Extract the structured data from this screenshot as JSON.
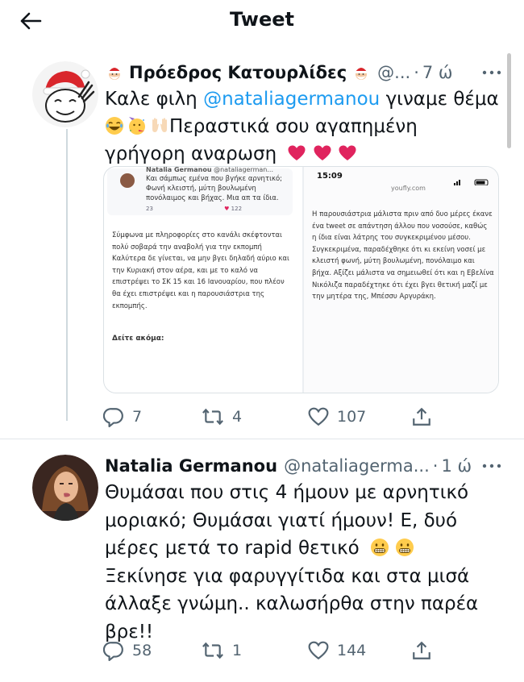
{
  "header": {
    "title": "Tweet"
  },
  "tweet1": {
    "display_name": "Πρόεδρος Κατουρλίδες",
    "handle": "@...",
    "dot": "·",
    "time": "7 ώ",
    "text_prefix": "Καλε φιλη",
    "mention": "@nataliagermanou",
    "text_mid": "γιναμε θέμα",
    "text_line2": "Περαστικά σου αγαπημένη",
    "text_line3": "γρήγορη αναρωση",
    "replies": "7",
    "retweets": "4",
    "likes": "107"
  },
  "media": {
    "embed_name": "Natalia Germanou",
    "embed_handle": "@nataliagerman...",
    "embed_text": [
      "Και σάμπως εμένα που βγήκε αρνητικό;",
      "Φωνή κλειστή, μύτη βουλωμένη",
      "πονόλαιμος και βήχας. Μια απ τα ίδια."
    ],
    "embed_replies": "23",
    "embed_likes": "122",
    "left_paragraph": [
      "Σύμφωνα με πληροφορίες στο κανάλι σκέφτονται",
      "πολύ σοβαρά την αναβολή για την εκπομπή",
      "Καλύτερα δε γίνεται, να μην βγει δηλαδή αύριο και",
      "την Κυριακή στον αέρα, και με το καλό να",
      "επιστρέψει το ΣΚ 15 και 16 Ιανουαρίου, που πλέον",
      "θα έχει επιστρέψει και η παρουσιάστρια της",
      "εκπομπής."
    ],
    "read_more": "Δείτε ακόμα:",
    "phone_time": "15:09",
    "site": "youfly.com",
    "right_paragraph": [
      "Η παρουσιάστρια μάλιστα πριν από δυο μέρες έκανε",
      "ένα tweet σε απάντηση άλλου που νοσούσε, καθώς",
      "η ίδια είναι λάτρης του συγκεκριμένου μέσου.",
      "Συγκεκριμένα, παραδέχθηκε ότι κι εκείνη νοσεί με",
      "κλειστή φωνή, μύτη βουλωμένη, πονόλαιμο και",
      "βήχα. Αξίζει μάλιστα να σημειωθεί ότι και η Εβελίνα",
      "Νικόλιζα παραδέχτηκε ότι έχει βγει θετική μαζί με",
      "την μητέρα της, Μπέσσυ Αργυράκη."
    ]
  },
  "tweet2": {
    "display_name": "Natalia Germanou",
    "handle": "@nataliagerma...",
    "dot": "·",
    "time": "1 ώ",
    "lines": [
      "Θυμάσαι που στις 4 ήμουν με αρνητικό",
      "μοριακό; Θυμάσαι γιατί ήμουν! Ε, δυό",
      "μέρες μετά το rapid θετικό",
      "Ξεκίνησε για φαρυγγίτιδα και στα μισά",
      "άλλαξε γνώμη.. καλωσήρθα στην παρέα",
      "βρε!!"
    ],
    "replies": "58",
    "retweets": "1",
    "likes": "144"
  },
  "colors": {
    "accent": "#1d9bf0",
    "text": "#0f1419",
    "secondary": "#536471",
    "heart": "#e0245e"
  },
  "icons": [
    "back-arrow-icon",
    "santa-icon",
    "more-icon",
    "reply-icon",
    "retweet-icon",
    "like-icon",
    "share-icon",
    "heart-emoji-icon",
    "laugh-emoji-icon",
    "party-emoji-icon",
    "raised-hands-emoji-icon",
    "grimace-emoji-icon"
  ]
}
